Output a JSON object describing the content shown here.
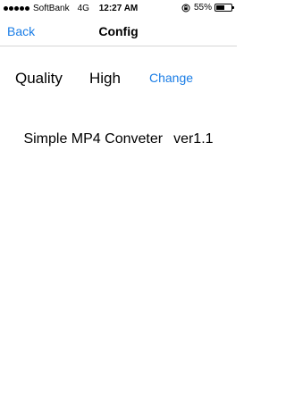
{
  "status_bar": {
    "carrier": "SoftBank",
    "network": "4G",
    "time": "12:27 AM",
    "battery_percent": "55%",
    "battery_level": 0.55,
    "icons": [
      "signal-dots-icon",
      "orientation-lock-icon",
      "battery-icon"
    ]
  },
  "nav": {
    "back_label": "Back",
    "title": "Config"
  },
  "settings": {
    "quality_label": "Quality",
    "quality_value": "High",
    "change_label": "Change"
  },
  "app_info": {
    "name": "Simple MP4 Conveter",
    "version": "ver1.1"
  },
  "colors": {
    "accent": "#1a7de6",
    "background": "#ffffff",
    "text": "#000000"
  }
}
